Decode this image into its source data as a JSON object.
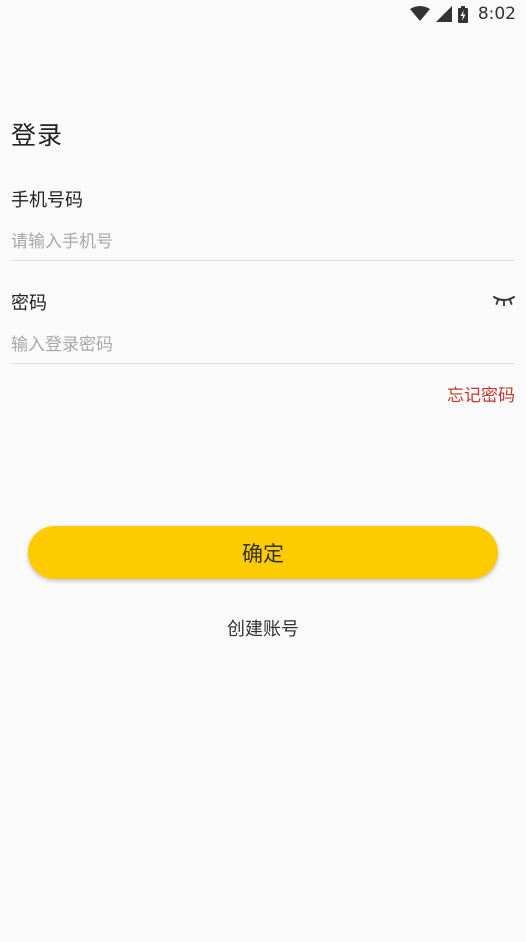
{
  "status_bar": {
    "time": "8:02",
    "icons": [
      "wifi-icon",
      "cell-signal-icon",
      "battery-icon"
    ]
  },
  "page": {
    "title": "登录"
  },
  "phone_field": {
    "label": "手机号码",
    "placeholder": "请输入手机号",
    "value": ""
  },
  "password_field": {
    "label": "密码",
    "placeholder": "输入登录密码",
    "value": "",
    "toggle_icon": "eye-closed-icon"
  },
  "links": {
    "forgot_password": "忘记密码",
    "create_account": "创建账号"
  },
  "buttons": {
    "confirm": "确定"
  },
  "colors": {
    "primary_button": "#fecb00",
    "forgot_link": "#c0392b",
    "background": "#fafafa"
  }
}
